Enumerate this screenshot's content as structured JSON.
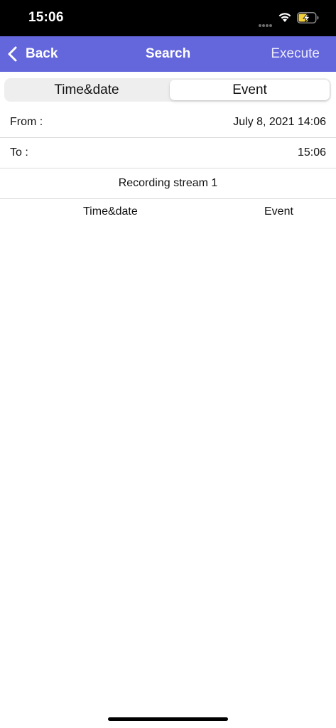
{
  "status_bar": {
    "time": "15:06",
    "icons": [
      "cellular-dots-icon",
      "wifi-icon",
      "battery-charging-icon"
    ],
    "battery_color": "#f4d03f"
  },
  "nav": {
    "back_label": "Back",
    "title": "Search",
    "execute_label": "Execute",
    "background_color": "#6466dc"
  },
  "segmented": {
    "options": [
      "Time&date",
      "Event"
    ],
    "selected": "Event"
  },
  "filters": {
    "from_label": "From :",
    "from_value": "July 8, 2021 14:06",
    "to_label": "To :",
    "to_value": "15:06",
    "stream": "Recording stream 1"
  },
  "table": {
    "columns": [
      "Time&date",
      "Event"
    ],
    "rows": []
  }
}
